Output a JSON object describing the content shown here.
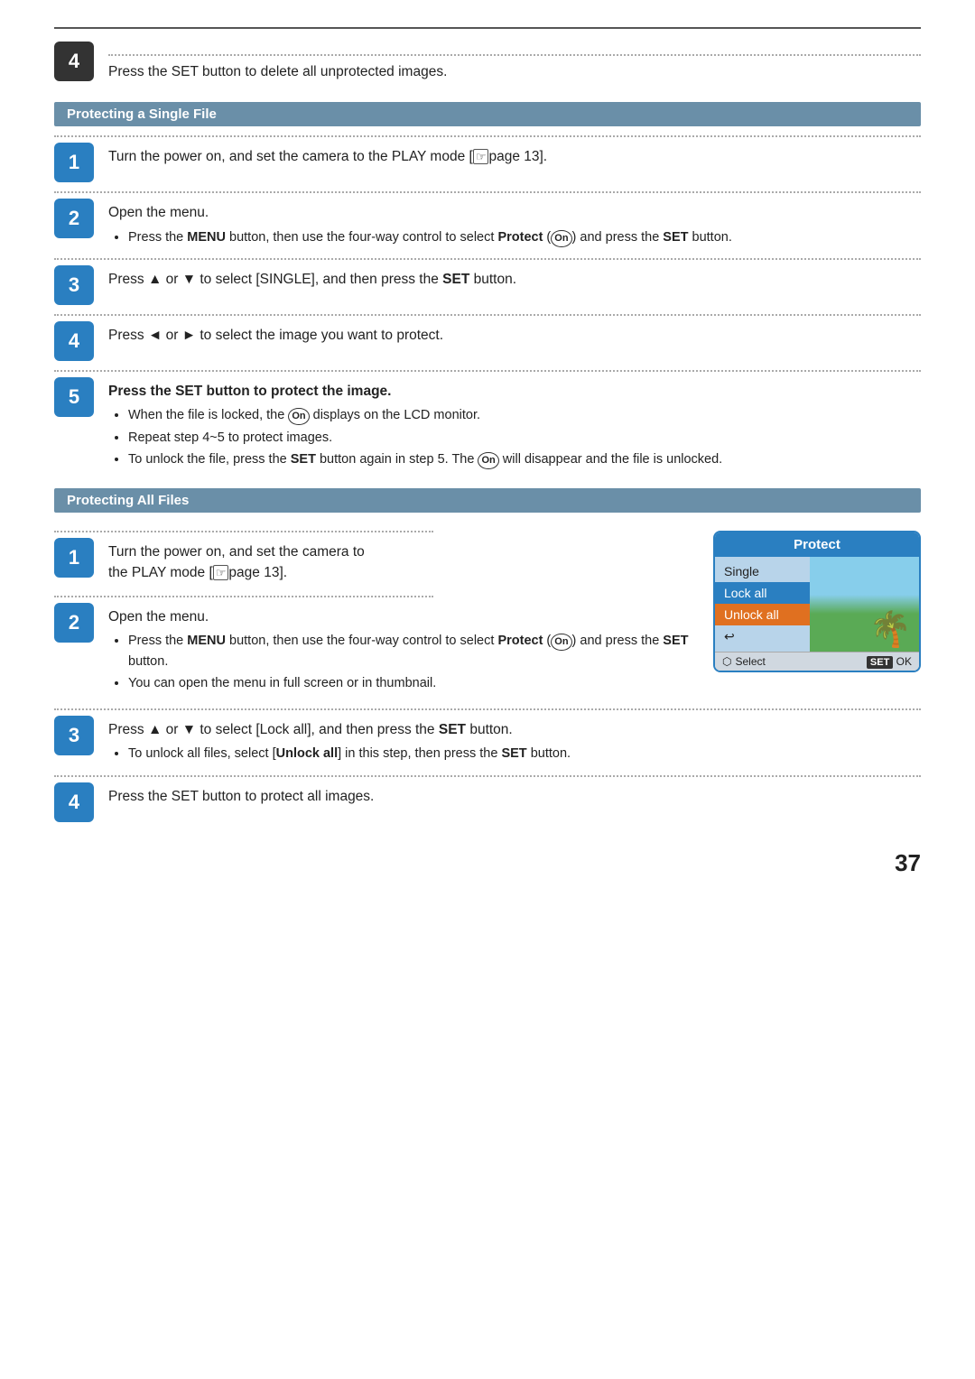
{
  "page": {
    "number": "37",
    "top_step": {
      "num": "4",
      "text": "Press the SET button to delete all unprotected images."
    },
    "section1": {
      "title": "Protecting a Single File",
      "steps": [
        {
          "num": "1",
          "text": "Turn the power on, and set the camera to the PLAY mode [",
          "text2": "page 13]."
        },
        {
          "num": "2",
          "label": "Open the menu.",
          "bullets": [
            "Press the MENU button, then use the four-way control to select Protect (On) and press the SET button."
          ]
        },
        {
          "num": "3",
          "text": "Press ▲ or ▼ to select [SINGLE], and then press the SET button."
        },
        {
          "num": "4",
          "text": "Press ◄ or ► to select the image you want to protect."
        },
        {
          "num": "5",
          "label": "Press the SET button to protect the image.",
          "bullets": [
            "When the file is locked, the On displays on the LCD monitor.",
            "Repeat step 4~5 to protect images.",
            "To unlock the file, press the SET button again in step 5. The On will disappear and the file is unlocked."
          ]
        }
      ]
    },
    "section2": {
      "title": "Protecting All Files",
      "steps": [
        {
          "num": "1",
          "text": "Turn the power on, and set the camera to the PLAY mode [",
          "text2": "page 13]."
        },
        {
          "num": "2",
          "label": "Open the menu.",
          "bullets": [
            "Press the MENU button, then use the four-way control to select Protect (On) and press the SET button.",
            "You can open the menu in full screen or in thumbnail."
          ]
        },
        {
          "num": "3",
          "text": "Press ▲ or ▼ to select [Lock all], and then press the SET button.",
          "bullets": [
            "To unlock all files, select [Unlock all] in this step, then press the SET button."
          ]
        },
        {
          "num": "4",
          "text": "Press the SET button to protect all images."
        }
      ]
    },
    "protect_dialog": {
      "title": "Protect",
      "menu_items": [
        {
          "label": "Single",
          "style": "normal"
        },
        {
          "label": "Lock all",
          "style": "blue"
        },
        {
          "label": "Unlock all",
          "style": "orange"
        },
        {
          "label": "↩",
          "style": "normal"
        }
      ],
      "footer": {
        "select_label": "⬡ Select",
        "ok_label": "SET OK"
      }
    }
  }
}
